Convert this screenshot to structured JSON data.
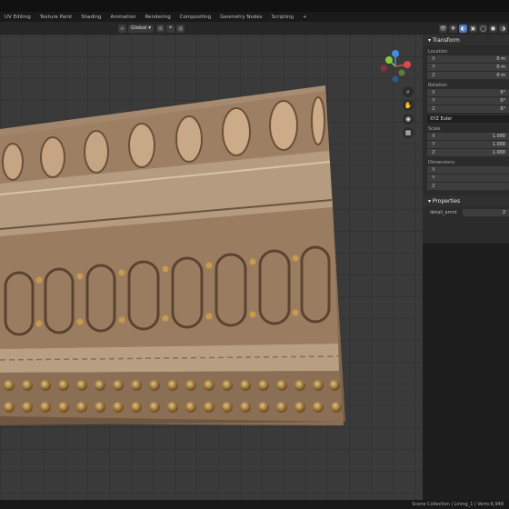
{
  "workspace_tabs": [
    "UV Editing",
    "Texture Paint",
    "Shading",
    "Animation",
    "Rendering",
    "Compositing",
    "Geometry Nodes",
    "Scripting",
    "+"
  ],
  "header": {
    "orientation": "Global"
  },
  "gizmo": {
    "axes": [
      "X",
      "Y",
      "Z"
    ],
    "colors": {
      "x": "#e0474c",
      "y": "#8cc63f",
      "z": "#3f8fe0"
    }
  },
  "npanel": {
    "title": "Transform",
    "location_label": "Location",
    "location": [
      {
        "axis": "X",
        "value": "0 m"
      },
      {
        "axis": "Y",
        "value": "0 m"
      },
      {
        "axis": "Z",
        "value": "0 m"
      }
    ],
    "rotation_label": "Rotation",
    "rotation": [
      {
        "axis": "X",
        "value": "0°"
      },
      {
        "axis": "Y",
        "value": "0°"
      },
      {
        "axis": "Z",
        "value": "0°"
      }
    ],
    "rotation_mode": "XYZ Euler",
    "scale_label": "Scale",
    "scale": [
      {
        "axis": "X",
        "value": "1.000"
      },
      {
        "axis": "Y",
        "value": "1.000"
      },
      {
        "axis": "Z",
        "value": "1.000"
      }
    ],
    "dimensions_label": "Dimensions",
    "dimensions": [
      {
        "axis": "X",
        "value": ""
      },
      {
        "axis": "Y",
        "value": ""
      },
      {
        "axis": "Z",
        "value": ""
      }
    ],
    "properties_label": "Properties",
    "prop_name": "detail_amnt",
    "prop_value": "2"
  },
  "status": "Scene Collection | Lining_1 | Verts:6,948"
}
